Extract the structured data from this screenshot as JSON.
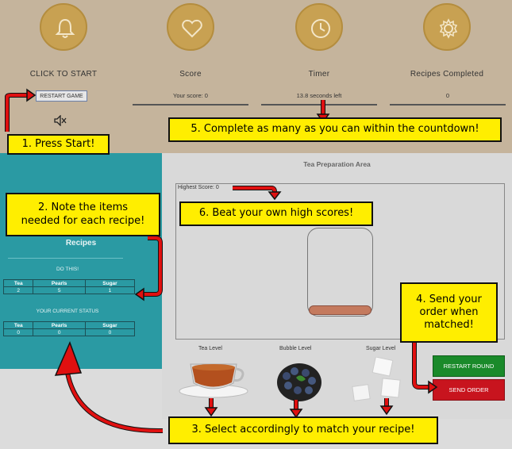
{
  "header": {
    "start_label": "CLICK TO START",
    "score_label": "Score",
    "timer_label": "Timer",
    "recipes_label": "Recipes Completed",
    "score_value": "Your score: 0",
    "timer_value": "13.8 seconds left",
    "recipes_value": "0",
    "restart_game": "RESTART GAME"
  },
  "icons": [
    "bell-icon",
    "heart-icon",
    "clock-icon",
    "gear-icon",
    "mute-icon"
  ],
  "recipes": {
    "title": "Recipes",
    "do_this": "DO THIS!",
    "current_status": "YOUR CURRENT STATUS",
    "columns": [
      "Tea",
      "Pearls",
      "Sugar"
    ],
    "target": [
      "2",
      "5",
      "1"
    ],
    "current": [
      "0",
      "0",
      "0"
    ]
  },
  "prep": {
    "title": "Tea Preparation Area",
    "highest_score": "Highest Score: 0",
    "tea_level": "Tea Level",
    "bubble_level": "Bubble Level",
    "sugar_level": "Sugar Level",
    "restart_round": "RESTART ROUND",
    "send_order": "SEND ORDER"
  },
  "callouts": {
    "c1": "1.  Press Start!",
    "c2a": "2.  Note the items",
    "c2b": "needed for each recipe!",
    "c3": "3. Select accordingly to match your recipe!",
    "c4a": "4. Send your",
    "c4b": "order when",
    "c4c": "matched!",
    "c5": "5. Complete as many as you can within the countdown!",
    "c6": "6. Beat your own high scores!"
  },
  "colors": {
    "header_bg": "#c5b49c",
    "icon_circle": "#c8a152",
    "panel_teal": "#2a9aa3",
    "callout_yellow": "#ffee00",
    "arrow_red": "#e01010",
    "restart_round": "#1a8a2a",
    "send_order": "#c8141e"
  }
}
